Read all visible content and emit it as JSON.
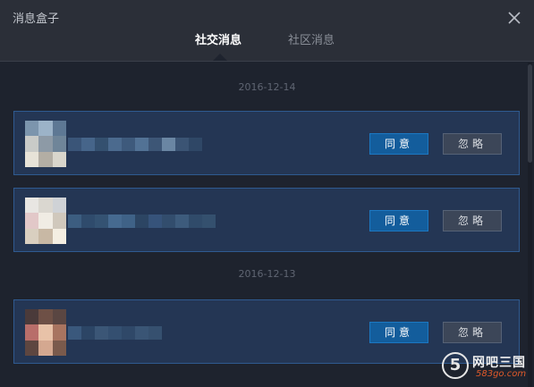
{
  "window": {
    "title": "消息盒子"
  },
  "tabs": [
    {
      "label": "社交消息",
      "active": true
    },
    {
      "label": "社区消息",
      "active": false
    }
  ],
  "groups": [
    {
      "date": "2016-12-14",
      "items": [
        {
          "agree_label": "同意",
          "ignore_label": "忽略"
        },
        {
          "agree_label": "同意",
          "ignore_label": "忽略"
        }
      ]
    },
    {
      "date": "2016-12-13",
      "items": [
        {
          "agree_label": "同意",
          "ignore_label": "忽略"
        }
      ]
    }
  ],
  "watermark": {
    "digit": "5",
    "name": "网吧三国",
    "site": "583go.com"
  },
  "colors": {
    "background": "#1e232e",
    "card": "#243654",
    "card_border": "#2f5a90",
    "agree_button": "#135d9c",
    "ignore_button": "#3c4658"
  }
}
